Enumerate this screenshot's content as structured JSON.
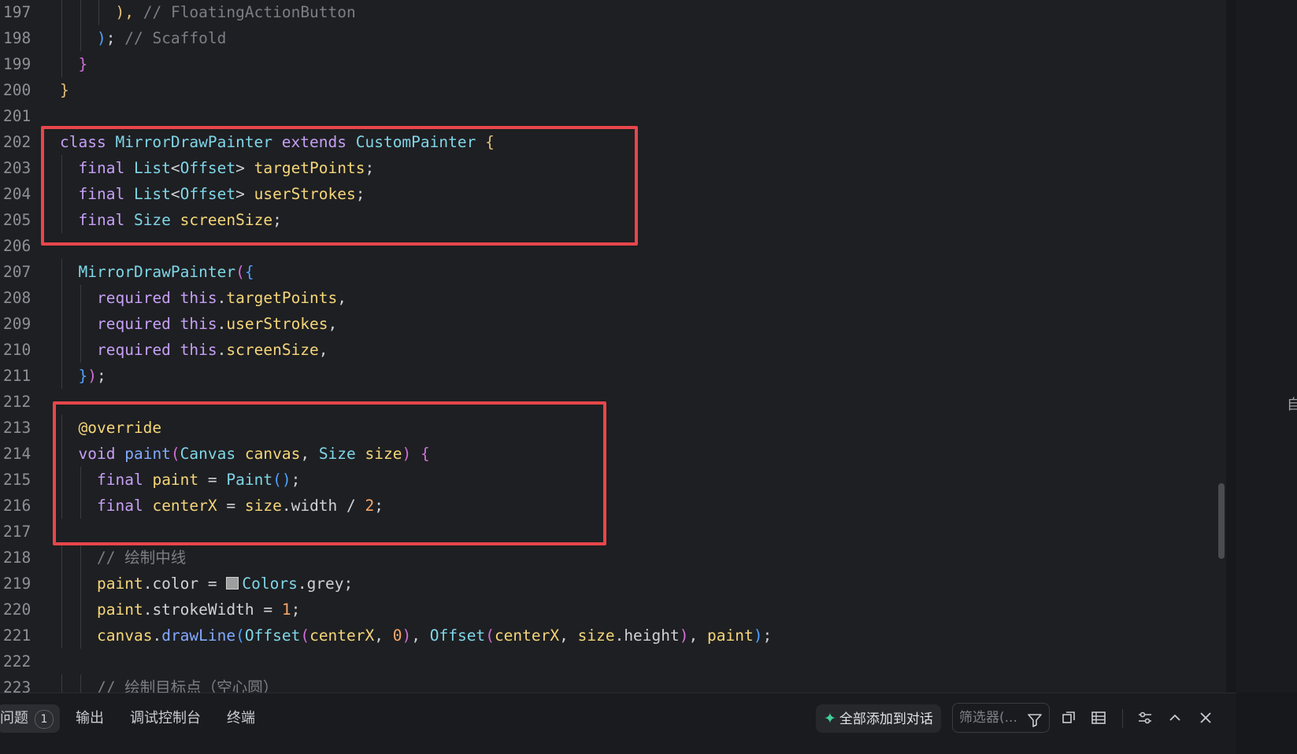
{
  "editor": {
    "lines": [
      {
        "n": "197",
        "indent": 3,
        "tokens": [
          [
            "br1",
            "),"
          ],
          [
            "plain",
            " "
          ],
          [
            "cm",
            "// FloatingActionButton"
          ]
        ]
      },
      {
        "n": "198",
        "indent": 2,
        "tokens": [
          [
            "br3",
            ")"
          ],
          [
            "plain",
            "; "
          ],
          [
            "cm",
            "// Scaffold"
          ]
        ]
      },
      {
        "n": "199",
        "indent": 1,
        "tokens": [
          [
            "br2",
            "}"
          ]
        ]
      },
      {
        "n": "200",
        "indent": 0,
        "tokens": [
          [
            "br1",
            "}"
          ]
        ]
      },
      {
        "n": "201",
        "indent": 0,
        "tokens": []
      },
      {
        "n": "202",
        "indent": 0,
        "tokens": [
          [
            "kw",
            "class"
          ],
          [
            "plain",
            " "
          ],
          [
            "ty",
            "MirrorDrawPainter"
          ],
          [
            "plain",
            " "
          ],
          [
            "kw",
            "extends"
          ],
          [
            "plain",
            " "
          ],
          [
            "ty",
            "CustomPainter"
          ],
          [
            "plain",
            " "
          ],
          [
            "br1",
            "{"
          ]
        ]
      },
      {
        "n": "203",
        "indent": 1,
        "tokens": [
          [
            "kw",
            "final"
          ],
          [
            "plain",
            " "
          ],
          [
            "ty",
            "List"
          ],
          [
            "plain",
            "<"
          ],
          [
            "ty",
            "Offset"
          ],
          [
            "plain",
            "> "
          ],
          [
            "va",
            "targetPoints"
          ],
          [
            "plain",
            ";"
          ]
        ]
      },
      {
        "n": "204",
        "indent": 1,
        "tokens": [
          [
            "kw",
            "final"
          ],
          [
            "plain",
            " "
          ],
          [
            "ty",
            "List"
          ],
          [
            "plain",
            "<"
          ],
          [
            "ty",
            "Offset"
          ],
          [
            "plain",
            "> "
          ],
          [
            "va",
            "userStrokes"
          ],
          [
            "plain",
            ";"
          ]
        ]
      },
      {
        "n": "205",
        "indent": 1,
        "tokens": [
          [
            "kw",
            "final"
          ],
          [
            "plain",
            " "
          ],
          [
            "ty",
            "Size"
          ],
          [
            "plain",
            " "
          ],
          [
            "va",
            "screenSize"
          ],
          [
            "plain",
            ";"
          ]
        ]
      },
      {
        "n": "206",
        "indent": 0,
        "tokens": []
      },
      {
        "n": "207",
        "indent": 1,
        "tokens": [
          [
            "ty",
            "MirrorDrawPainter"
          ],
          [
            "br2",
            "("
          ],
          [
            "br3",
            "{"
          ]
        ]
      },
      {
        "n": "208",
        "indent": 2,
        "tokens": [
          [
            "kw",
            "required"
          ],
          [
            "plain",
            " "
          ],
          [
            "kw",
            "this"
          ],
          [
            "plain",
            "."
          ],
          [
            "va",
            "targetPoints"
          ],
          [
            "plain",
            ","
          ]
        ]
      },
      {
        "n": "209",
        "indent": 2,
        "tokens": [
          [
            "kw",
            "required"
          ],
          [
            "plain",
            " "
          ],
          [
            "kw",
            "this"
          ],
          [
            "plain",
            "."
          ],
          [
            "va",
            "userStrokes"
          ],
          [
            "plain",
            ","
          ]
        ]
      },
      {
        "n": "210",
        "indent": 2,
        "tokens": [
          [
            "kw",
            "required"
          ],
          [
            "plain",
            " "
          ],
          [
            "kw",
            "this"
          ],
          [
            "plain",
            "."
          ],
          [
            "va",
            "screenSize"
          ],
          [
            "plain",
            ","
          ]
        ]
      },
      {
        "n": "211",
        "indent": 1,
        "tokens": [
          [
            "br3",
            "}"
          ],
          [
            "br2",
            ")"
          ],
          [
            "plain",
            ";"
          ]
        ]
      },
      {
        "n": "212",
        "indent": 0,
        "tokens": []
      },
      {
        "n": "213",
        "indent": 1,
        "tokens": [
          [
            "va",
            "@override"
          ]
        ]
      },
      {
        "n": "214",
        "indent": 1,
        "tokens": [
          [
            "kw",
            "void"
          ],
          [
            "plain",
            " "
          ],
          [
            "fn",
            "paint"
          ],
          [
            "br2",
            "("
          ],
          [
            "ty",
            "Canvas"
          ],
          [
            "plain",
            " "
          ],
          [
            "va",
            "canvas"
          ],
          [
            "plain",
            ", "
          ],
          [
            "ty",
            "Size"
          ],
          [
            "plain",
            " "
          ],
          [
            "va",
            "size"
          ],
          [
            "br2",
            ")"
          ],
          [
            "plain",
            " "
          ],
          [
            "br2",
            "{"
          ]
        ]
      },
      {
        "n": "215",
        "indent": 2,
        "tokens": [
          [
            "kw",
            "final"
          ],
          [
            "plain",
            " "
          ],
          [
            "va",
            "paint"
          ],
          [
            "plain",
            " = "
          ],
          [
            "ty",
            "Paint"
          ],
          [
            "br3",
            "()"
          ],
          [
            "plain",
            ";"
          ]
        ]
      },
      {
        "n": "216",
        "indent": 2,
        "tokens": [
          [
            "kw",
            "final"
          ],
          [
            "plain",
            " "
          ],
          [
            "va",
            "centerX"
          ],
          [
            "plain",
            " = "
          ],
          [
            "va",
            "size"
          ],
          [
            "plain",
            ".width / "
          ],
          [
            "nm",
            "2"
          ],
          [
            "plain",
            ";"
          ]
        ]
      },
      {
        "n": "217",
        "indent": 0,
        "tokens": []
      },
      {
        "n": "218",
        "indent": 2,
        "tokens": [
          [
            "cm",
            "// 绘制中线"
          ]
        ]
      },
      {
        "n": "219",
        "indent": 2,
        "tokens": [
          [
            "va",
            "paint"
          ],
          [
            "plain",
            ".color = "
          ],
          [
            "swatch",
            ""
          ],
          [
            "ty",
            "Colors"
          ],
          [
            "plain",
            ".grey;"
          ]
        ]
      },
      {
        "n": "220",
        "indent": 2,
        "tokens": [
          [
            "va",
            "paint"
          ],
          [
            "plain",
            ".strokeWidth = "
          ],
          [
            "nm",
            "1"
          ],
          [
            "plain",
            ";"
          ]
        ]
      },
      {
        "n": "221",
        "indent": 2,
        "tokens": [
          [
            "va",
            "canvas"
          ],
          [
            "plain",
            "."
          ],
          [
            "fn",
            "drawLine"
          ],
          [
            "br3",
            "("
          ],
          [
            "ty",
            "Offset"
          ],
          [
            "br2",
            "("
          ],
          [
            "va",
            "centerX"
          ],
          [
            "plain",
            ", "
          ],
          [
            "nm",
            "0"
          ],
          [
            "br2",
            ")"
          ],
          [
            "plain",
            ", "
          ],
          [
            "ty",
            "Offset"
          ],
          [
            "br2",
            "("
          ],
          [
            "va",
            "centerX"
          ],
          [
            "plain",
            ", "
          ],
          [
            "va",
            "size"
          ],
          [
            "plain",
            ".height"
          ],
          [
            "br2",
            ")"
          ],
          [
            "plain",
            ", "
          ],
          [
            "va",
            "paint"
          ],
          [
            "br3",
            ")"
          ],
          [
            "plain",
            ";"
          ]
        ]
      },
      {
        "n": "222",
        "indent": 0,
        "tokens": []
      },
      {
        "n": "223",
        "indent": 2,
        "tokens": [
          [
            "cm",
            "// 绘制目标点（空心圆）"
          ]
        ]
      }
    ]
  },
  "right_strip": {
    "char": "自"
  },
  "panel": {
    "tabs": [
      {
        "label": "问题",
        "badge": "1",
        "active": true
      },
      {
        "label": "输出"
      },
      {
        "label": "调试控制台"
      },
      {
        "label": "终端"
      }
    ],
    "add_all_label": "全部添加到对话",
    "filter_placeholder": "筛选器(..."
  },
  "colors": {
    "highlight_box": "#e8464b",
    "editor_bg": "#1e1f22"
  }
}
